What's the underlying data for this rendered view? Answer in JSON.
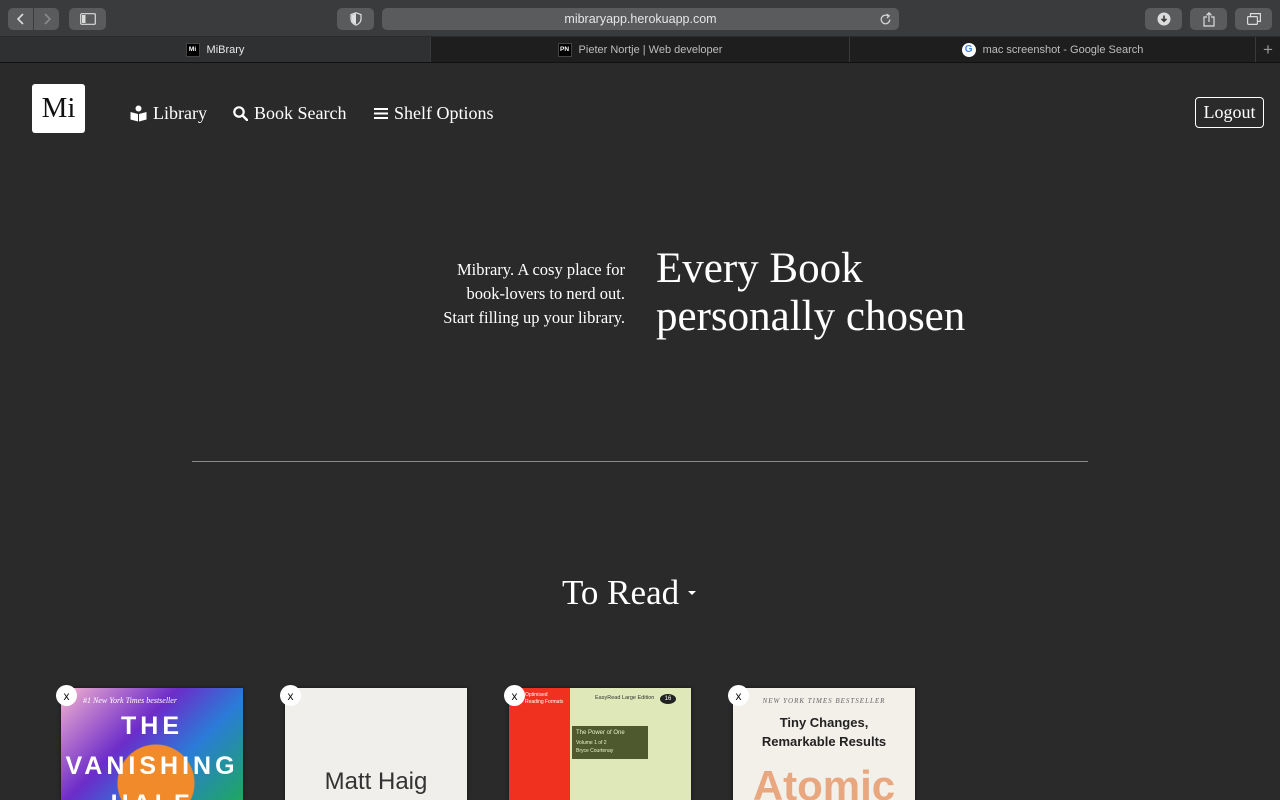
{
  "browser": {
    "url": "mibraryapp.herokuapp.com",
    "tabs": [
      {
        "label": "MiBrary",
        "favicon": "Mi",
        "active": true
      },
      {
        "label": "Pieter Nortje | Web developer",
        "favicon": "PN",
        "active": false
      },
      {
        "label": "mac screenshot - Google Search",
        "favicon": "G",
        "active": false
      }
    ],
    "new_tab_label": "+"
  },
  "app": {
    "logo": "Mi",
    "nav": [
      {
        "label": "Library",
        "icon": "book-reader-icon"
      },
      {
        "label": "Book Search",
        "icon": "search-icon"
      },
      {
        "label": "Shelf Options",
        "icon": "menu-icon"
      }
    ],
    "logout_label": "Logout"
  },
  "hero": {
    "tagline_lines": [
      "Mibrary. A cosy place for",
      "book-lovers to nerd out.",
      "Start filling up your library."
    ],
    "headline_lines": [
      "Every Book",
      "personally chosen"
    ]
  },
  "shelf": {
    "title": "To Read",
    "remove_label": "x",
    "books": [
      {
        "cover_text": [
          "#1 New York Times bestseller",
          "THE",
          "VANISHING",
          "HALF"
        ]
      },
      {
        "cover_text": [
          "Matt Haig"
        ]
      },
      {
        "cover_text": [
          "Optimised",
          "Reading Formats",
          "EasyRead Large Edition",
          "16",
          "The Power of One",
          "Volume 1 of 2",
          "Bryce Courtenay"
        ]
      },
      {
        "cover_text": [
          "NEW YORK TIMES BESTSELLER",
          "Tiny Changes,",
          "Remarkable Results",
          "Atomic"
        ]
      }
    ]
  },
  "colors": {
    "page_bg": "#2a2a2a",
    "toolbar_bg": "#3a3b3d",
    "text": "#ffffff"
  }
}
